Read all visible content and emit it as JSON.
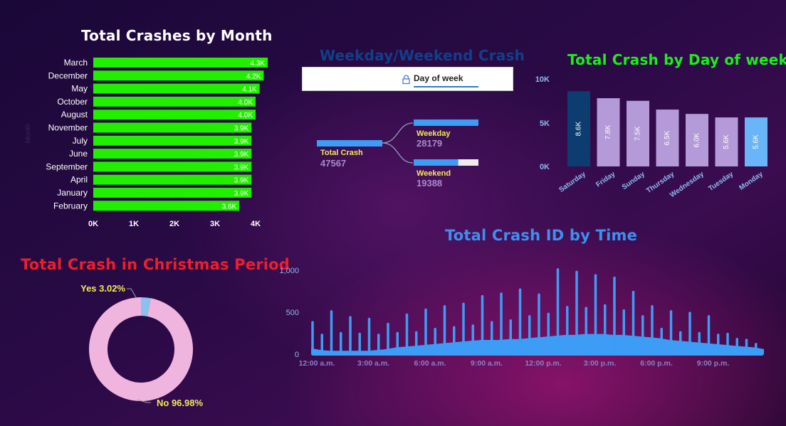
{
  "colors": {
    "month_bar": "#22ee00",
    "day_highlight": "#0d3d70",
    "day_bar": "#b49ad8",
    "day_selected": "#6ab4f8",
    "time_line": "#3d9cf5",
    "donut_no": "#efb5df",
    "donut_yes": "#8cc0ef",
    "title_green": "#1aef1a",
    "title_red": "#ee1d2e",
    "title_blue": "#3d8ff0",
    "title_darkblue": "#123f8a"
  },
  "month_chart": {
    "title": "Total Crashes by Month",
    "ylabel": "Month"
  },
  "tree": {
    "title": "Weekday/Weekend Crash",
    "filter_label": "Day of week",
    "filter_icon": "lock-icon",
    "root": {
      "label": "Total Crash",
      "value": "47567"
    },
    "children": [
      {
        "label": "Weekday",
        "value": "28179",
        "share": 1.0
      },
      {
        "label": "Weekend",
        "value": "19388",
        "share": 0.688
      }
    ]
  },
  "dow_chart": {
    "title": "Total Crash by Day of week"
  },
  "christmas_chart": {
    "title": "Total Crash in Christmas Period"
  },
  "time_chart": {
    "title": "Total Crash ID by Time"
  },
  "chart_data": [
    {
      "type": "bar",
      "orientation": "horizontal",
      "title": "Total Crashes by Month",
      "ylabel": "Month",
      "categories": [
        "March",
        "December",
        "May",
        "October",
        "August",
        "November",
        "July",
        "June",
        "September",
        "April",
        "January",
        "February"
      ],
      "values": [
        4300,
        4200,
        4100,
        4000,
        4000,
        3900,
        3900,
        3900,
        3900,
        3900,
        3900,
        3600
      ],
      "data_labels": [
        "4.3K",
        "4.2K",
        "4.1K",
        "4.0K",
        "4.0K",
        "3.9K",
        "3.9K",
        "3.9K",
        "3.9K",
        "3.9K",
        "3.9K",
        "3.6K"
      ],
      "xticks": [
        "0K",
        "1K",
        "2K",
        "3K",
        "4K"
      ],
      "xlim": [
        0,
        4300
      ]
    },
    {
      "type": "bar",
      "title": "Total Crash by Day of week",
      "categories": [
        "Saturday",
        "Friday",
        "Sunday",
        "Thursday",
        "Wednesday",
        "Tuesday",
        "Monday"
      ],
      "values": [
        8600,
        7800,
        7500,
        6500,
        6000,
        5600,
        5600
      ],
      "data_labels": [
        "8.6K",
        "7.8K",
        "7.5K",
        "6.5K",
        "6.0K",
        "5.6K",
        "5.6K"
      ],
      "yticks": [
        "0K",
        "5K",
        "10K"
      ],
      "ylim": [
        0,
        10000
      ]
    },
    {
      "type": "pie",
      "style": "donut",
      "title": "Total Crash in Christmas Period",
      "slices": [
        {
          "name": "Yes",
          "value": 3.02,
          "label": "Yes 3.02%"
        },
        {
          "name": "No",
          "value": 96.98,
          "label": "No 96.98%"
        }
      ]
    },
    {
      "type": "line",
      "title": "Total Crash ID by Time",
      "yticks": [
        "0",
        "500",
        "1,000"
      ],
      "ylim": [
        0,
        1000
      ],
      "xticks": [
        "12:00 a.m.",
        "3:00 a.m.",
        "6:00 a.m.",
        "9:00 a.m.",
        "12:00 p.m.",
        "3:00 p.m.",
        "6:00 p.m.",
        "9:00 p.m."
      ],
      "x_hours": [
        0,
        0.5,
        1,
        1.5,
        2,
        2.5,
        3,
        3.5,
        4,
        4.5,
        5,
        5.5,
        6,
        6.5,
        7,
        7.5,
        8,
        8.5,
        9,
        9.5,
        10,
        10.5,
        11,
        11.5,
        12,
        12.5,
        13,
        13.5,
        14,
        14.5,
        15,
        15.5,
        16,
        16.5,
        17,
        17.5,
        18,
        18.5,
        19,
        19.5,
        20,
        20.5,
        21,
        21.5,
        22,
        22.5,
        23,
        23.5
      ],
      "values": [
        380,
        230,
        510,
        250,
        440,
        240,
        420,
        230,
        360,
        250,
        470,
        260,
        530,
        300,
        570,
        320,
        600,
        340,
        690,
        380,
        720,
        400,
        770,
        450,
        710,
        480,
        1010,
        560,
        980,
        550,
        940,
        580,
        910,
        520,
        740,
        450,
        570,
        300,
        510,
        260,
        490,
        250,
        450,
        230,
        240,
        180,
        170,
        120
      ],
      "baseline": [
        70,
        50,
        40,
        40,
        40,
        40,
        40,
        50,
        60,
        80,
        90,
        100,
        110,
        120,
        130,
        140,
        150,
        160,
        170,
        170,
        170,
        180,
        180,
        190,
        200,
        210,
        220,
        230,
        230,
        240,
        240,
        240,
        230,
        230,
        220,
        210,
        200,
        190,
        170,
        160,
        150,
        140,
        130,
        120,
        110,
        100,
        90,
        80
      ]
    }
  ]
}
